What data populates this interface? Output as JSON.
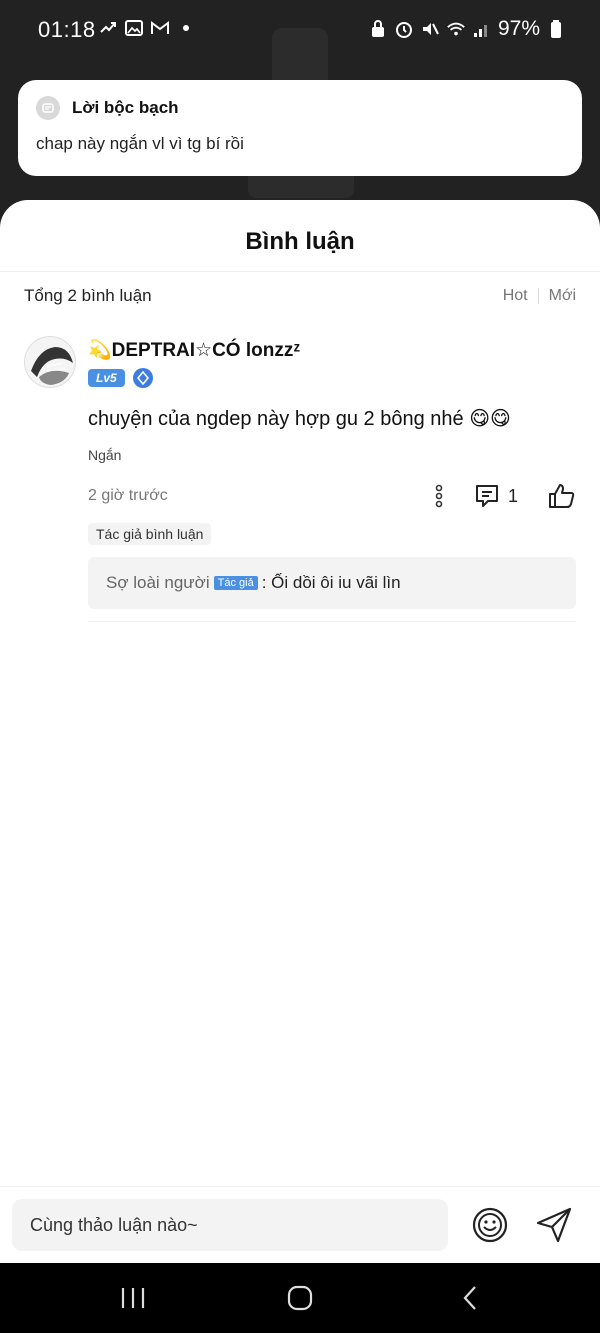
{
  "status_bar": {
    "time": "01:18",
    "battery": "97%",
    "left_icons": [
      "notification-icon",
      "image-icon",
      "gmail-icon",
      "dot-icon"
    ],
    "right_icons": [
      "lock-icon",
      "alarm-icon",
      "mute-icon",
      "wifi-icon",
      "signal-icon",
      "battery-icon"
    ]
  },
  "note": {
    "title": "Lời bộc bạch",
    "body": "chap này ngắn vl vì tg bí rồi"
  },
  "sheet": {
    "title": "Bình luận",
    "total_label": "Tổng 2 bình luận",
    "sort_hot": "Hot",
    "sort_new": "Mới"
  },
  "comment": {
    "username": "💫DEPTRAI☆CÓ lonzzᶻ",
    "level": "Lv5",
    "text": "chuyện của ngdep này hợp gu 2 bông nhé 😋😋",
    "short_label": "Ngắn",
    "time": "2 giờ trước",
    "reply_count": "1",
    "author_tag": "Tác giả bình luận",
    "reply": {
      "name": "Sợ loài người",
      "tag": "Tác giả",
      "text": ": Ối dồi ôi iu vãi lìn"
    }
  },
  "input": {
    "placeholder": "Cùng thảo luận nào~"
  },
  "colors": {
    "accent": "#4a90e2",
    "background_dark": "#222222"
  }
}
